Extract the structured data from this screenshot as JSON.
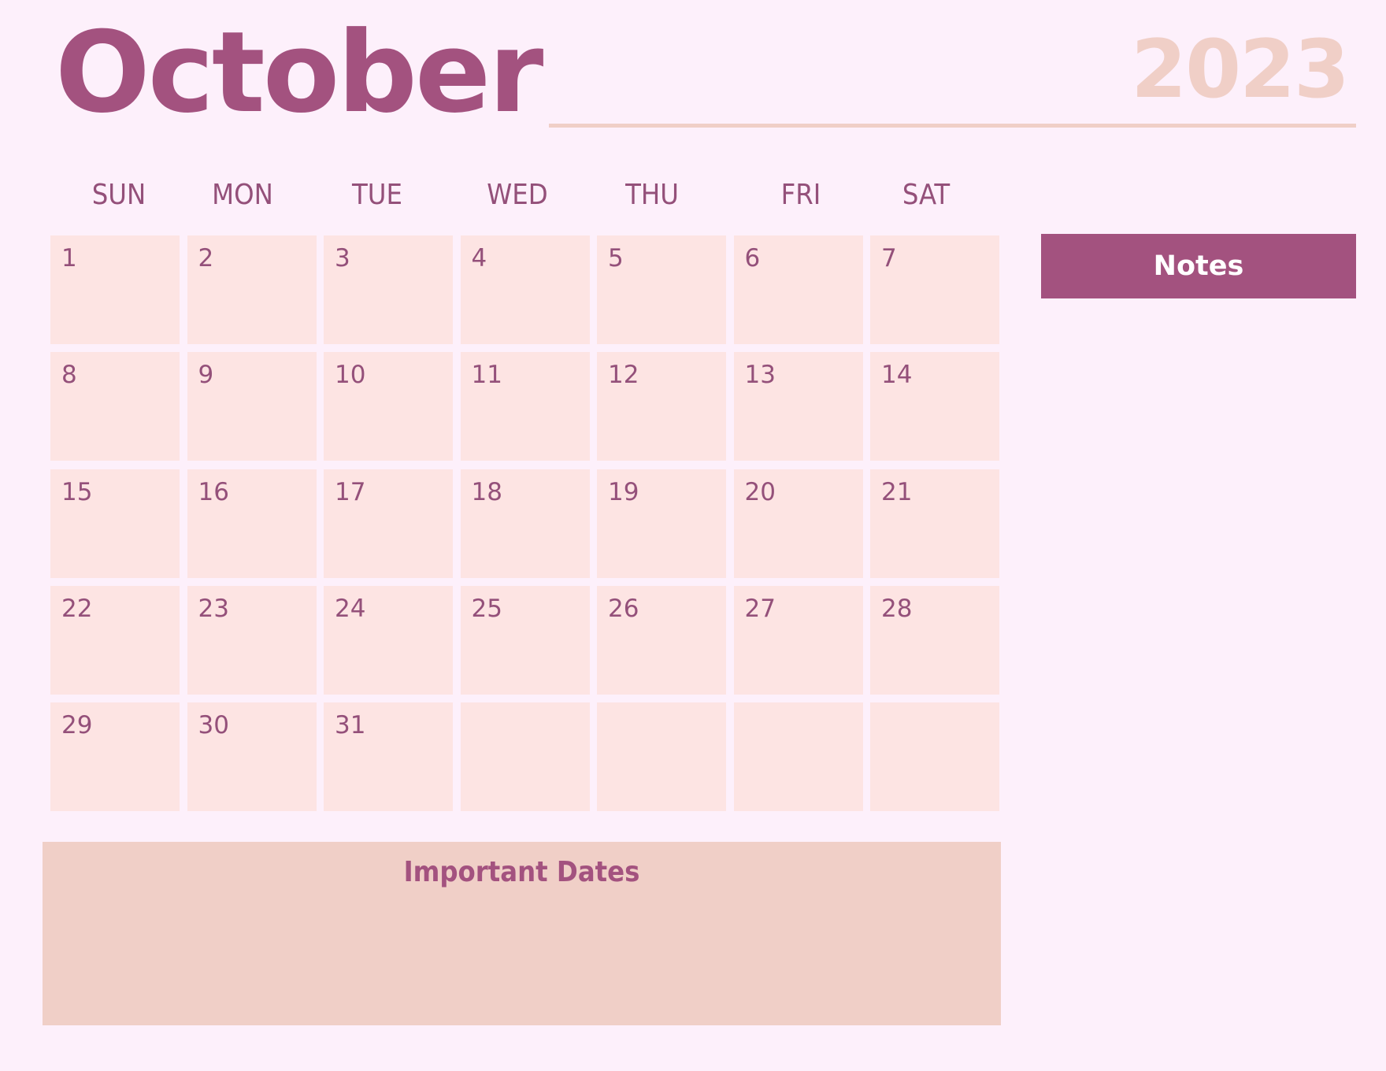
{
  "header": {
    "month": "October",
    "year": "2023"
  },
  "weekdays": [
    "SUN",
    "MON",
    "TUE",
    "WED",
    "THU",
    "FRI",
    "SAT"
  ],
  "weeks": [
    [
      "1",
      "2",
      "3",
      "4",
      "5",
      "6",
      "7"
    ],
    [
      "8",
      "9",
      "10",
      "11",
      "12",
      "13",
      "14"
    ],
    [
      "15",
      "16",
      "17",
      "18",
      "19",
      "20",
      "21"
    ],
    [
      "22",
      "23",
      "24",
      "25",
      "26",
      "27",
      "28"
    ],
    [
      "29",
      "30",
      "31",
      "",
      "",
      "",
      ""
    ]
  ],
  "notes": {
    "label": "Notes"
  },
  "important_dates": {
    "label": "Important Dates"
  },
  "colors": {
    "accent": "#a3527f",
    "background": "#fdf0fb",
    "cell": "#fde4e3",
    "soft": "#f0cfc7",
    "text": "#94507a"
  }
}
